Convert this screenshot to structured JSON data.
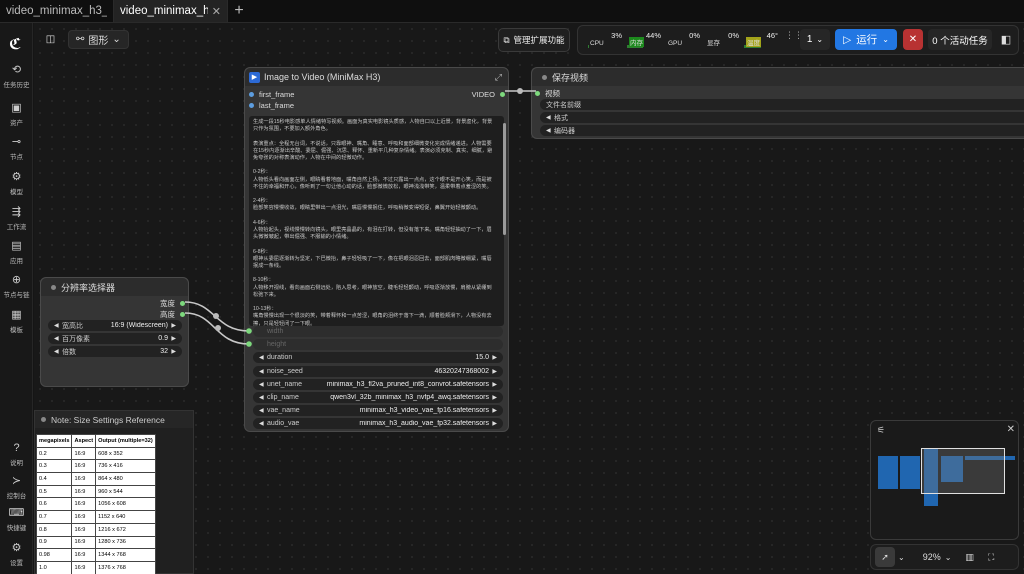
{
  "tabs": [
    {
      "label": "video_minimax_h3_i..."
    },
    {
      "label": "video_minimax_h3_t..."
    }
  ],
  "sidebar": {
    "items": [
      {
        "icon": "history-icon",
        "glyph": "⟲",
        "label": "任务历史"
      },
      {
        "icon": "assets-icon",
        "glyph": "▣",
        "label": "资产"
      },
      {
        "icon": "nodes-icon",
        "glyph": "⊸",
        "label": "节点"
      },
      {
        "icon": "models-icon",
        "glyph": "⚙",
        "label": "模型"
      },
      {
        "icon": "workflow-icon",
        "glyph": "⇶",
        "label": "工作流"
      },
      {
        "icon": "apps-icon",
        "glyph": "▤",
        "label": "应用"
      },
      {
        "icon": "node-library-icon",
        "glyph": "⊕",
        "label": "节点与链"
      },
      {
        "icon": "templates-icon",
        "glyph": "▦",
        "label": "模板"
      }
    ],
    "bottom": [
      {
        "icon": "help-icon",
        "glyph": "?",
        "label": "说明"
      },
      {
        "icon": "console-icon",
        "glyph": "≻",
        "label": "控制台"
      },
      {
        "icon": "shortcut-icon",
        "glyph": "⌨",
        "label": "快捷键"
      },
      {
        "icon": "settings-icon",
        "glyph": "⚙",
        "label": "设置"
      }
    ]
  },
  "toolbar": {
    "graph_label": "图形",
    "ext_label": "管理扩展功能",
    "run_label": "运行",
    "queue_count": "1",
    "active_tasks": "0 个活动任务"
  },
  "resources": [
    {
      "name": "CPU",
      "pct": "3%",
      "fill": 0.03
    },
    {
      "name": "内存",
      "pct": "44%",
      "fill": 0.44
    },
    {
      "name": "GPU",
      "pct": "0%",
      "fill": 0.0
    },
    {
      "name": "显存",
      "pct": "0%",
      "fill": 0.0
    },
    {
      "name": "温度",
      "pct": "46°",
      "fill": 0.46
    }
  ],
  "node_video": {
    "title": "Image to Video (MiniMax H3)",
    "inputs": [
      "first_frame",
      "last_frame"
    ],
    "output": "VIDEO",
    "prompt": "生成一段15秒电影感单人情绪特写视频。画面为真实电影镜头质感，人物自口以上近景，背景虚化，背景只作为氛围，不要加入额外角色。\n\n表演重点：全程无台词，不说话，只靠眼神、嘴角、睡意、呼吸和面部细微变化完成情绪递进。人物需要在15秒内逐渐出辛酸、委屈、倔强、沉思、释怀、重新平几种复杂情绪。表演必须克制、真实、细腻，避免夸张的对称表演动作，人物在中间的轻微动作。\n\n0-2秒：\n人物低头看向画面左侧，眼睛看着地面，嘴角自然上扬，不过只露出一点点，这个眼不是开心笑，而是被不住的幸福和开心，像听到了一句让他心动的话，脸部微微放松，眼神浅浅带笑，温柔带着点羞涩的笑。\n\n2-4秒：\n脸部笑容慢慢收敛，眼睛里带出一点泪光，嘴唇慢慢抿住，呼吸稍微变得短促，鼻翼开始轻微颤动。\n\n4-6秒：\n人物抬起头，视线慢慢转向镜头，眼里亮晶晶的，有泪在打转，但没有落下来。嘴角轻轻抽动了一下，眉头微微皱起，带出倔强、不服输的小情绪。\n\n6-8秒：\n眼神从委屈逐渐转为坚定，下巴微抬，鼻子轻轻吸了一下，像在把眼泪忍回去，面部肌肉略微绷紧，嘴唇抿成一条线。\n\n8-10秒：\n人物移开视线，看向画面右侧远处，陷入思考，眼神放空，睫毛轻轻颤动，呼吸逐渐放慢，肩膀从紧绷到松弛下来。\n\n10-13秒：\n嘴角慢慢出现一个很淡的笑，带着释怀和一点苦涩，眼角的泪终于落下一滴，顺着脸颊滑下，人物没有去擦，只是轻轻闭了一下眼。\n\n13-15秒：\n人物重新睁开眼，看向镜头，眼神平静而温和，带着一种经历过情绪起伏后的安定，嘴角保持淡淡的微笑，画面定格。",
    "widgets": [
      {
        "label": "width",
        "value": "",
        "disabled": true
      },
      {
        "label": "height",
        "value": "",
        "disabled": true
      },
      {
        "label": "duration",
        "value": "15.0"
      },
      {
        "label": "noise_seed",
        "value": "46320247368002"
      },
      {
        "label": "unet_name",
        "value": "minimax_h3_fl2va_pruned_int8_convrot.safetensors"
      },
      {
        "label": "clip_name",
        "value": "qwen3vl_32b_minimax_h3_nvfp4_awq.safetensors"
      },
      {
        "label": "vae_name",
        "value": "minimax_h3_video_vae_fp16.safetensors"
      },
      {
        "label": "audio_vae",
        "value": "minimax_h3_audio_vae_fp32.safetensors"
      }
    ]
  },
  "node_save": {
    "title": "保存视频",
    "input": "视频",
    "widgets": [
      "文件名前缀",
      "格式",
      "编码器"
    ]
  },
  "node_res": {
    "title": "分辨率选择器",
    "outputs": [
      "宽度",
      "高度"
    ],
    "widgets": [
      {
        "label": "宽高比",
        "value": "16:9 (Widescreen)"
      },
      {
        "label": "百万像素",
        "value": "0.9"
      },
      {
        "label": "倍数",
        "value": "32"
      }
    ]
  },
  "note": {
    "title": "Note: Size Settings Reference",
    "columns": [
      "megapixels",
      "Aspect",
      "Output (multiple=32)"
    ],
    "rows": [
      [
        "0.2",
        "16:9",
        "608 x 352"
      ],
      [
        "0.3",
        "16:9",
        "736 x 416"
      ],
      [
        "0.4",
        "16:9",
        "864 x 480"
      ],
      [
        "0.5",
        "16:9",
        "960 x 544"
      ],
      [
        "0.6",
        "16:9",
        "1056 x 608"
      ],
      [
        "0.7",
        "16:9",
        "1152 x 640"
      ],
      [
        "0.8",
        "16:9",
        "1216 x 672"
      ],
      [
        "0.9",
        "16:9",
        "1280 x 736"
      ],
      [
        "0.98",
        "16:9",
        "1344 x 768"
      ],
      [
        "1.0",
        "16:9",
        "1376 x 768"
      ]
    ]
  },
  "zoom": "92%"
}
